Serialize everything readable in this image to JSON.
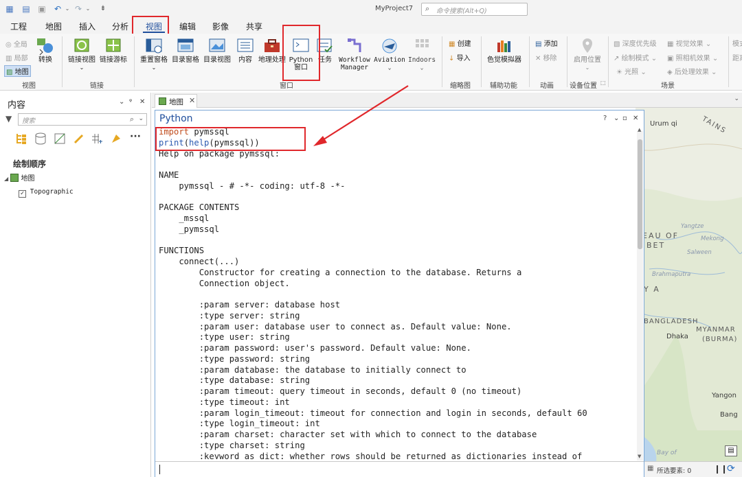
{
  "window": {
    "title": "MyProject7"
  },
  "command_search": {
    "placeholder": "命令搜索(Alt+Q)"
  },
  "ribbon_tabs": [
    "工程",
    "地图",
    "插入",
    "分析",
    "视图",
    "编辑",
    "影像",
    "共享"
  ],
  "active_tab": "视图",
  "ribbon": {
    "view_group": {
      "items": [
        "全局",
        "局部",
        "地图"
      ],
      "convert": "转换",
      "label": "视图"
    },
    "link_group": {
      "items": [
        "链接视图",
        "链接游标"
      ],
      "label": "链接"
    },
    "window_group": {
      "items": [
        "重置窗格",
        "目录窗格",
        "目录视图",
        "内容",
        "地理处理",
        "Python\n窗口",
        "任务",
        "Workflow\nManager",
        "Aviation",
        "Indoors"
      ],
      "label": "窗口"
    },
    "thumbnail_group": {
      "items": [
        "创建",
        "导入"
      ],
      "label": "缩略图"
    },
    "accessibility_group": {
      "items": [
        "色觉模拟器"
      ],
      "label": "辅助功能"
    },
    "animation_group": {
      "items": [
        "添加",
        "移除"
      ],
      "label": "动画"
    },
    "device_group": {
      "items": [
        "启用位置"
      ],
      "label": "设备位置"
    },
    "scene_group": {
      "items": [
        "深度优先级",
        "视觉效果",
        "绘制模式",
        "照相机效果",
        "光照",
        "后处理效果"
      ],
      "label": "场景"
    },
    "right_partial": [
      "模式",
      "距离"
    ]
  },
  "contents_pane": {
    "title": "内容",
    "controls": [
      "⌄",
      "ᵠ",
      "✕"
    ],
    "search_placeholder": "搜索",
    "section_title": "绘制顺序",
    "map_layer": "地图",
    "basemap_layer": "Topographic"
  },
  "doc_tab": {
    "label": "地图"
  },
  "python_window": {
    "title": "Python",
    "controls": [
      "?",
      "⌄",
      "▫",
      "✕"
    ],
    "input_lines": [
      {
        "kw": "import",
        "rest": " pymssql"
      },
      {
        "fn": "print",
        "rest_open": "(",
        "fn2": "help",
        "rest": "(pymssql))"
      }
    ],
    "output": [
      "Help on package pymssql:",
      "",
      "NAME",
      "    pymssql - # -*- coding: utf-8 -*-",
      "",
      "PACKAGE CONTENTS",
      "    _mssql",
      "    _pymssql",
      "",
      "FUNCTIONS",
      "    connect(...)",
      "        Constructor for creating a connection to the database. Returns a",
      "        Connection object.",
      "",
      "        :param server: database host",
      "        :type server: string",
      "        :param user: database user to connect as. Default value: None.",
      "        :type user: string",
      "        :param password: user's password. Default value: None.",
      "        :type password: string",
      "        :param database: the database to initially connect to",
      "        :type database: string",
      "        :param timeout: query timeout in seconds, default 0 (no timeout)",
      "        :type timeout: int",
      "        :param login_timeout: timeout for connection and login in seconds, default 60",
      "        :type login_timeout: int",
      "        :param charset: character set with which to connect to the database",
      "        :type charset: string",
      "        :keyword as_dict: whether rows should be returned as dictionaries instead of"
    ]
  },
  "map_labels": [
    "Urum qi",
    "TAINS",
    "Yangtze",
    "EAU OF",
    "Mekong",
    "BET",
    "Salween",
    "Brahmaputra",
    "Y A",
    "BANGLADESH",
    "Dhaka",
    "MYANMAR",
    "(BURMA)",
    "Yangon",
    "Bang",
    "Bay of"
  ],
  "status_bar": {
    "selected_features": "所选要素: 0"
  },
  "colors": {
    "accent": "#1f4e9c",
    "highlight_box": "#e0272b"
  }
}
